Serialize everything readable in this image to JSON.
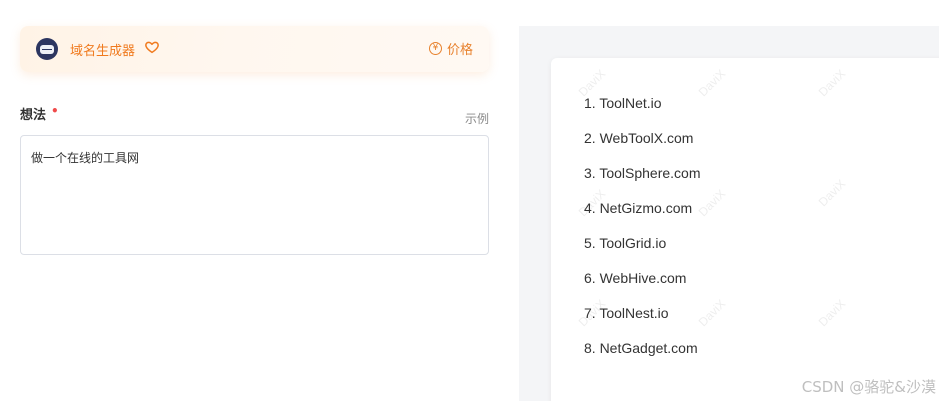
{
  "tool": {
    "name": "域名生成器",
    "price_label": "价格",
    "price_symbol": "¥",
    "logo_icon": "domain-generator-logo",
    "favorite_icon": "heart-outline-icon"
  },
  "form": {
    "idea_label": "想法",
    "required_mark": "•",
    "example_label": "示例",
    "idea_value": "做一个在线的工具网"
  },
  "results": [
    "1. ToolNet.io",
    "2. WebToolX.com",
    "3. ToolSphere.com",
    "4. NetGizmo.com",
    "5. ToolGrid.io",
    "6. WebHive.com",
    "7. ToolNest.io",
    "8. NetGadget.com"
  ],
  "watermark": {
    "text": "DaviX",
    "credit": "CSDN @骆驼&沙漠"
  },
  "colors": {
    "accent": "#f07a1e",
    "price": "#e8822e",
    "required": "#f04b4b",
    "panel_bg": "#f4f5f7"
  }
}
